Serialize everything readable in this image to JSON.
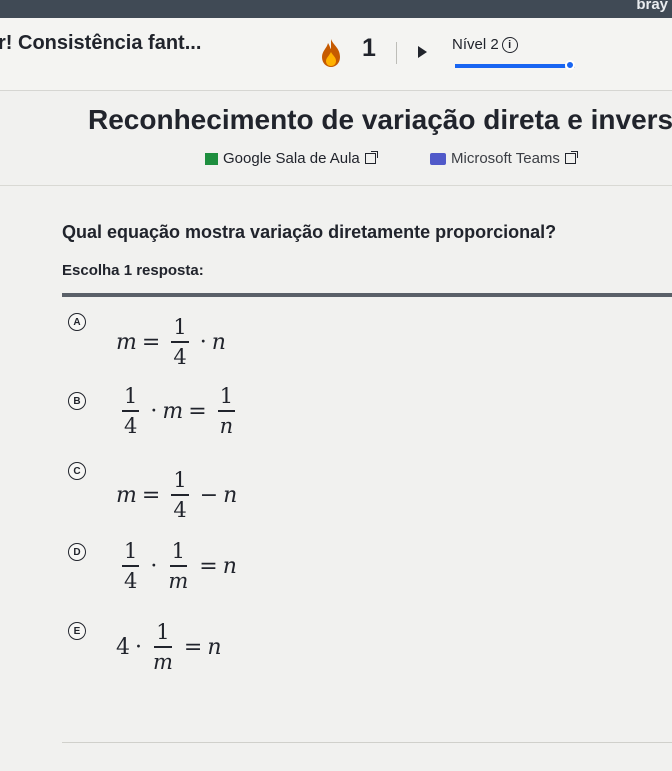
{
  "top_bar": {
    "brand": "bray"
  },
  "header": {
    "title": "r! Consistência fant...",
    "streak_count": "1",
    "level_label": "Nível 2",
    "info_symbol": "i"
  },
  "exercise": {
    "heading": "Reconhecimento de variação direta e invers",
    "share": {
      "google_classroom": "Google Sala de Aula",
      "microsoft_teams": "Microsoft Teams"
    },
    "question": "Qual equação mostra variação diretamente proporcional?",
    "instruction": "Escolha 1 resposta:",
    "choices": [
      {
        "letter": "A",
        "lhs_var": "m",
        "eq": "=",
        "num": "1",
        "den": "4",
        "op": "·",
        "rhs_var": "n"
      },
      {
        "letter": "B",
        "num1": "1",
        "den1": "4",
        "op": "·",
        "var": "m",
        "eq": "=",
        "num2": "1",
        "den2": "n"
      },
      {
        "letter": "C",
        "lhs_var": "m",
        "eq": "=",
        "num": "1",
        "den": "4",
        "op": "−",
        "rhs_var": "n"
      },
      {
        "letter": "D",
        "num1": "1",
        "den1": "4",
        "op": "·",
        "num2": "1",
        "den2": "m",
        "eq": "=",
        "var": "n"
      },
      {
        "letter": "E",
        "coef": "4",
        "op": "·",
        "num": "1",
        "den": "m",
        "eq": "=",
        "var": "n"
      }
    ]
  },
  "colors": {
    "accent": "#1865f2",
    "text": "#21242c",
    "top_bar": "#404a55"
  },
  "progress": {
    "level_progress_percent": 92
  }
}
